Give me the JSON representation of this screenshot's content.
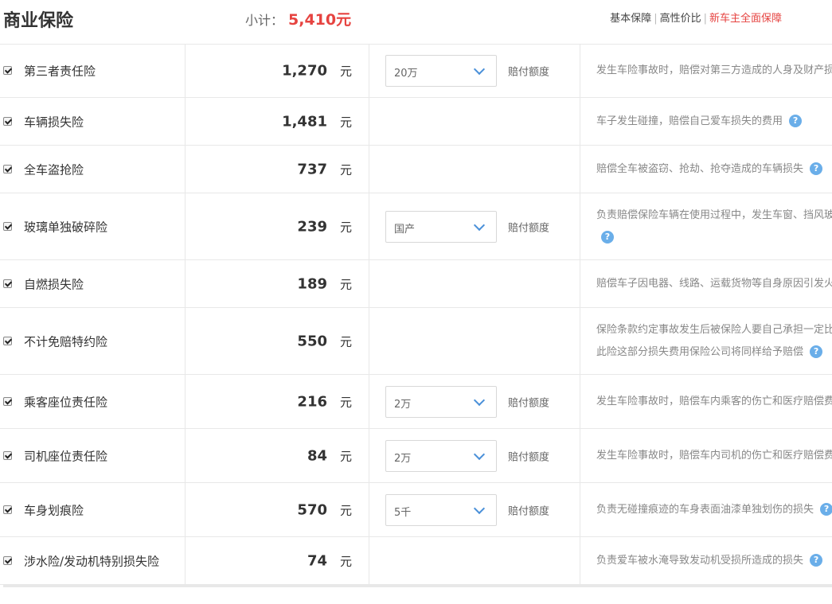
{
  "header": {
    "title": "商业保险",
    "subtotal_label": "小计：",
    "subtotal_value": "5,410元",
    "tabs": [
      "基本保障",
      "高性价比",
      "新车主全面保障"
    ]
  },
  "colors": {
    "accent": "#e64340",
    "help_icon": "#6aaee9",
    "select_arrow": "#4a90d9"
  },
  "unit": "元",
  "limit_label": "赔付额度",
  "rows": [
    {
      "name": "第三者责任险",
      "price": "1,270",
      "select": "20万",
      "desc": [
        "发生车险事故时，赔偿对第三方造成的人身及财产损失"
      ],
      "help": false,
      "height": 68
    },
    {
      "name": "车辆损失险",
      "price": "1,481",
      "select": "",
      "desc": [
        "车子发生碰撞，赔偿自己爱车损失的费用"
      ],
      "help": true,
      "height": 60
    },
    {
      "name": "全车盗抢险",
      "price": "737",
      "select": "",
      "desc": [
        "赔偿全车被盗窃、抢劫、抢夺造成的车辆损失"
      ],
      "help": true,
      "height": 60
    },
    {
      "name": "玻璃单独破碎险",
      "price": "239",
      "select": "国产",
      "desc": [
        "负责赔偿保险车辆在使用过程中，发生车窗、挡风玻璃单独破碎的损失"
      ],
      "help": true,
      "help_newline": true,
      "height": 84
    },
    {
      "name": "自燃损失险",
      "price": "189",
      "select": "",
      "desc": [
        "赔偿车子因电器、线路、运载货物等自身原因引发火灾造成的损失"
      ],
      "help": false,
      "height": 60
    },
    {
      "name": "不计免赔特约险",
      "price": "550",
      "select": "",
      "desc": [
        "保险条款约定事故发生后被保险人要自己承担一定比例的损失，",
        "此险这部分损失费用保险公司将同样给予赔偿"
      ],
      "help": true,
      "height": 84
    },
    {
      "name": "乘客座位责任险",
      "price": "216",
      "select": "2万",
      "desc": [
        "发生车险事故时，赔偿车内乘客的伤亡和医疗赔偿费用"
      ],
      "help": false,
      "height": 68
    },
    {
      "name": "司机座位责任险",
      "price": "84",
      "select": "2万",
      "desc": [
        "发生车险事故时，赔偿车内司机的伤亡和医疗赔偿费用"
      ],
      "help": false,
      "height": 68
    },
    {
      "name": "车身划痕险",
      "price": "570",
      "select": "5千",
      "desc": [
        "负责无碰撞痕迹的车身表面油漆单独划伤的损失"
      ],
      "help": true,
      "height": 68
    },
    {
      "name": "涉水险/发动机特别损失险",
      "price": "74",
      "select": "",
      "desc": [
        "负责爱车被水淹导致发动机受损所造成的损失"
      ],
      "help": true,
      "height": 60
    }
  ]
}
